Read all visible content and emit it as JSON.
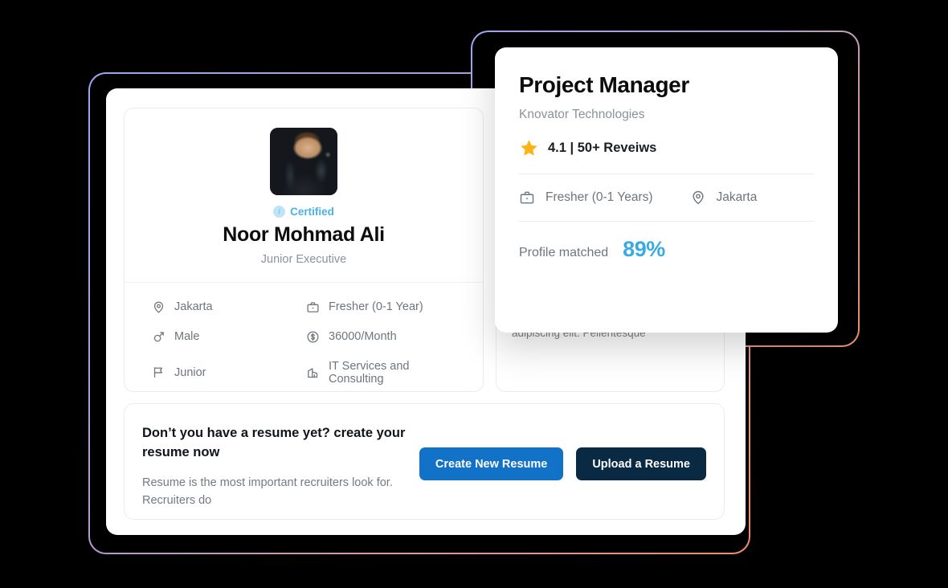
{
  "profile": {
    "certified_label": "Certified",
    "certified_icon": "verified-badge-icon",
    "name": "Noor Mohmad Ali",
    "role": "Junior Executive",
    "avatar_alt": "profile-photo",
    "details": [
      {
        "icon": "location-pin-icon",
        "value": "Jakarta"
      },
      {
        "icon": "briefcase-icon",
        "value": "Fresher (0-1 Year)"
      },
      {
        "icon": "male-gender-icon",
        "value": "Male"
      },
      {
        "icon": "dollar-circle-icon",
        "value": "36000/Month"
      },
      {
        "icon": "flag-icon",
        "value": "Junior"
      },
      {
        "icon": "building-icon",
        "value": "IT Services and Consulting"
      }
    ]
  },
  "back_card": {
    "text": "adipiscing elit. Pellentesque"
  },
  "resume": {
    "title": "Don’t you have a resume yet? create your resume now",
    "subtitle": "Resume is the most important recruiters look for. Recruiters do",
    "create_button": "Create New Resume",
    "upload_button": "Upload a Resume"
  },
  "job": {
    "title": "Project Manager",
    "company": "Knovator Technologies",
    "star_icon": "star-icon",
    "rating_text": "4.1 | 50+ Reveiws",
    "experience_icon": "briefcase-icon",
    "experience": "Fresher (0-1 Years)",
    "location_icon": "location-pin-icon",
    "location": "Jakarta",
    "match_label": "Profile matched",
    "match_value": "89%"
  },
  "colors": {
    "primary_blue": "#1272c8",
    "dark_navy": "#0a2a44",
    "accent_sky": "#38abe2",
    "star_gold": "#fbb414",
    "certified_blue": "#4db1e8",
    "frame_gradient_start": "#9aa7ee",
    "frame_gradient_end": "#ef8d6e",
    "background": "#000000"
  }
}
